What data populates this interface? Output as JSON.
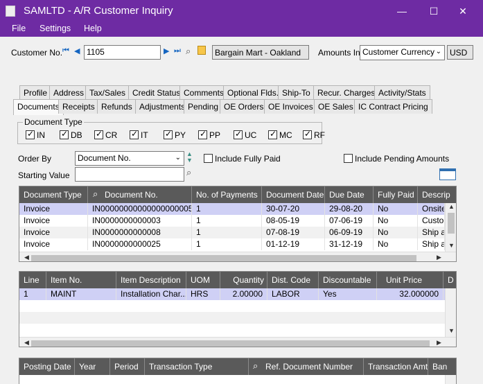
{
  "window": {
    "title": "SAMLTD - A/R Customer Inquiry",
    "min": "—",
    "max": "☐",
    "close": "✕"
  },
  "menu": [
    "File",
    "Settings",
    "Help"
  ],
  "header": {
    "customer_label": "Customer No.",
    "customer_value": "1105",
    "customer_name": "Bargain Mart - Oakland",
    "amounts_label": "Amounts In",
    "amounts_value": "Customer Currency",
    "currency": "USD"
  },
  "tabs_row1": [
    "Profile",
    "Address",
    "Tax/Sales",
    "Credit Status",
    "Comments",
    "Optional Flds.",
    "Ship-To",
    "Recur. Charges",
    "Activity/Stats"
  ],
  "tabs_row2": [
    "Documents",
    "Receipts",
    "Refunds",
    "Adjustments",
    "Pending",
    "OE Orders",
    "OE Invoices",
    "OE Sales",
    "IC Contract Pricing"
  ],
  "doc_type": {
    "legend": "Document Type",
    "items": [
      {
        "label": "IN",
        "checked": true
      },
      {
        "label": "DB",
        "checked": true
      },
      {
        "label": "CR",
        "checked": true
      },
      {
        "label": "IT",
        "checked": true
      },
      {
        "label": "PY",
        "checked": true
      },
      {
        "label": "PP",
        "checked": true
      },
      {
        "label": "UC",
        "checked": true
      },
      {
        "label": "MC",
        "checked": true
      },
      {
        "label": "RF",
        "checked": true
      }
    ]
  },
  "filters": {
    "order_by_label": "Order By",
    "order_by_value": "Document No.",
    "include_fully_paid": "Include Fully Paid",
    "include_pending": "Include Pending Amounts",
    "starting_value_label": "Starting Value",
    "starting_value": ""
  },
  "doc_grid": {
    "columns": [
      "Document Type",
      "Document No.",
      "No. of Payments",
      "Document Date",
      "Due Date",
      "Fully Paid",
      "Descrip"
    ],
    "rows": [
      [
        "Invoice",
        "IN00000000000000000005",
        "1",
        "30-07-20",
        "29-08-20",
        "No",
        "Onsite I"
      ],
      [
        "Invoice",
        "IN0000000000003",
        "1",
        "08-05-19",
        "07-06-19",
        "No",
        "Custom"
      ],
      [
        "Invoice",
        "IN0000000000008",
        "1",
        "07-08-19",
        "06-09-19",
        "No",
        "Ship as"
      ],
      [
        "Invoice",
        "IN0000000000025",
        "1",
        "01-12-19",
        "31-12-19",
        "No",
        "Ship as"
      ]
    ]
  },
  "detail_grid": {
    "columns": [
      "Line",
      "Item No.",
      "Item Description",
      "UOM",
      "Quantity",
      "Dist. Code",
      "Discountable",
      "Unit Price",
      "D"
    ],
    "rows": [
      [
        "1",
        "MAINT",
        "Installation Char...",
        "HRS",
        "2.00000",
        "LABOR",
        "Yes",
        "32.000000",
        ""
      ]
    ]
  },
  "posting_grid": {
    "columns": [
      "Posting Date",
      "Year",
      "Period",
      "Transaction Type",
      "Ref. Document Number",
      "Transaction Amt.",
      "Ban"
    ]
  }
}
